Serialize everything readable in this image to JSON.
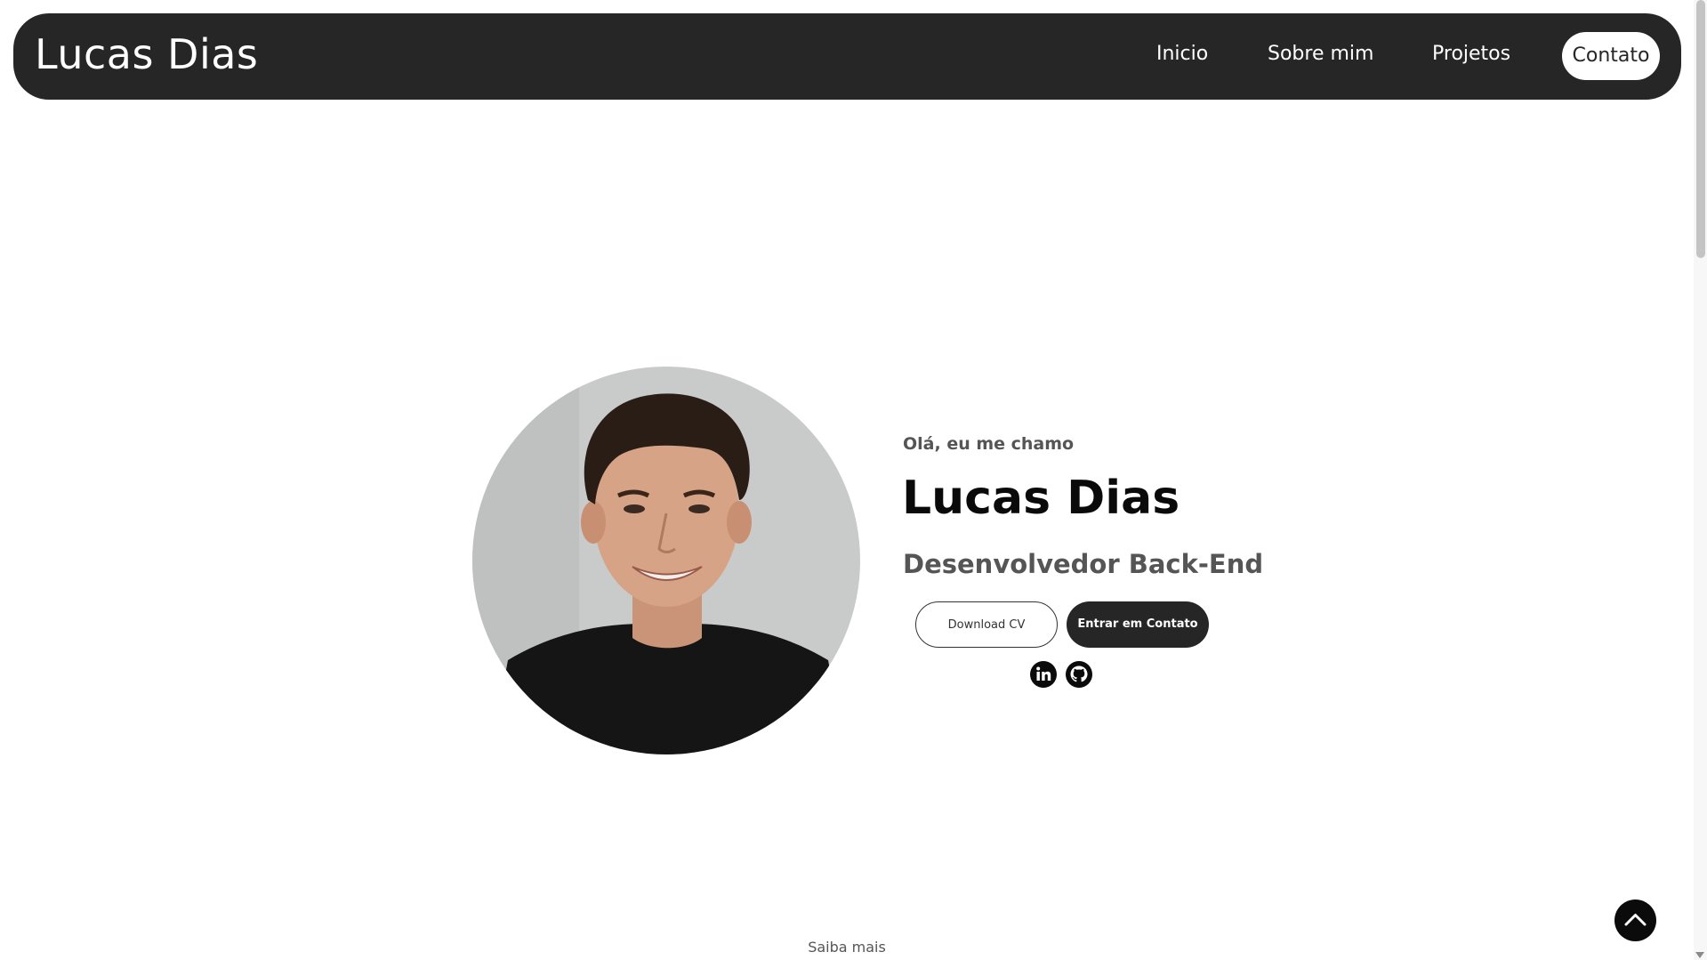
{
  "navbar": {
    "brand": "Lucas Dias",
    "links": [
      {
        "label": "Inicio"
      },
      {
        "label": "Sobre mim"
      },
      {
        "label": "Projetos"
      },
      {
        "label": "Contato"
      }
    ]
  },
  "hero": {
    "greeting": "Olá, eu me chamo",
    "name": "Lucas Dias",
    "role": "Desenvolvedor Back-End",
    "download_cv_label": "Download CV",
    "contact_label": "Entrar em Contato",
    "socials": [
      {
        "icon": "linkedin-icon"
      },
      {
        "icon": "github-icon"
      }
    ]
  },
  "footer_hint": "Saiba mais",
  "colors": {
    "navbar_bg": "#262626",
    "accent_dark": "#262626",
    "text_muted": "#555555",
    "background": "#ffffff"
  }
}
